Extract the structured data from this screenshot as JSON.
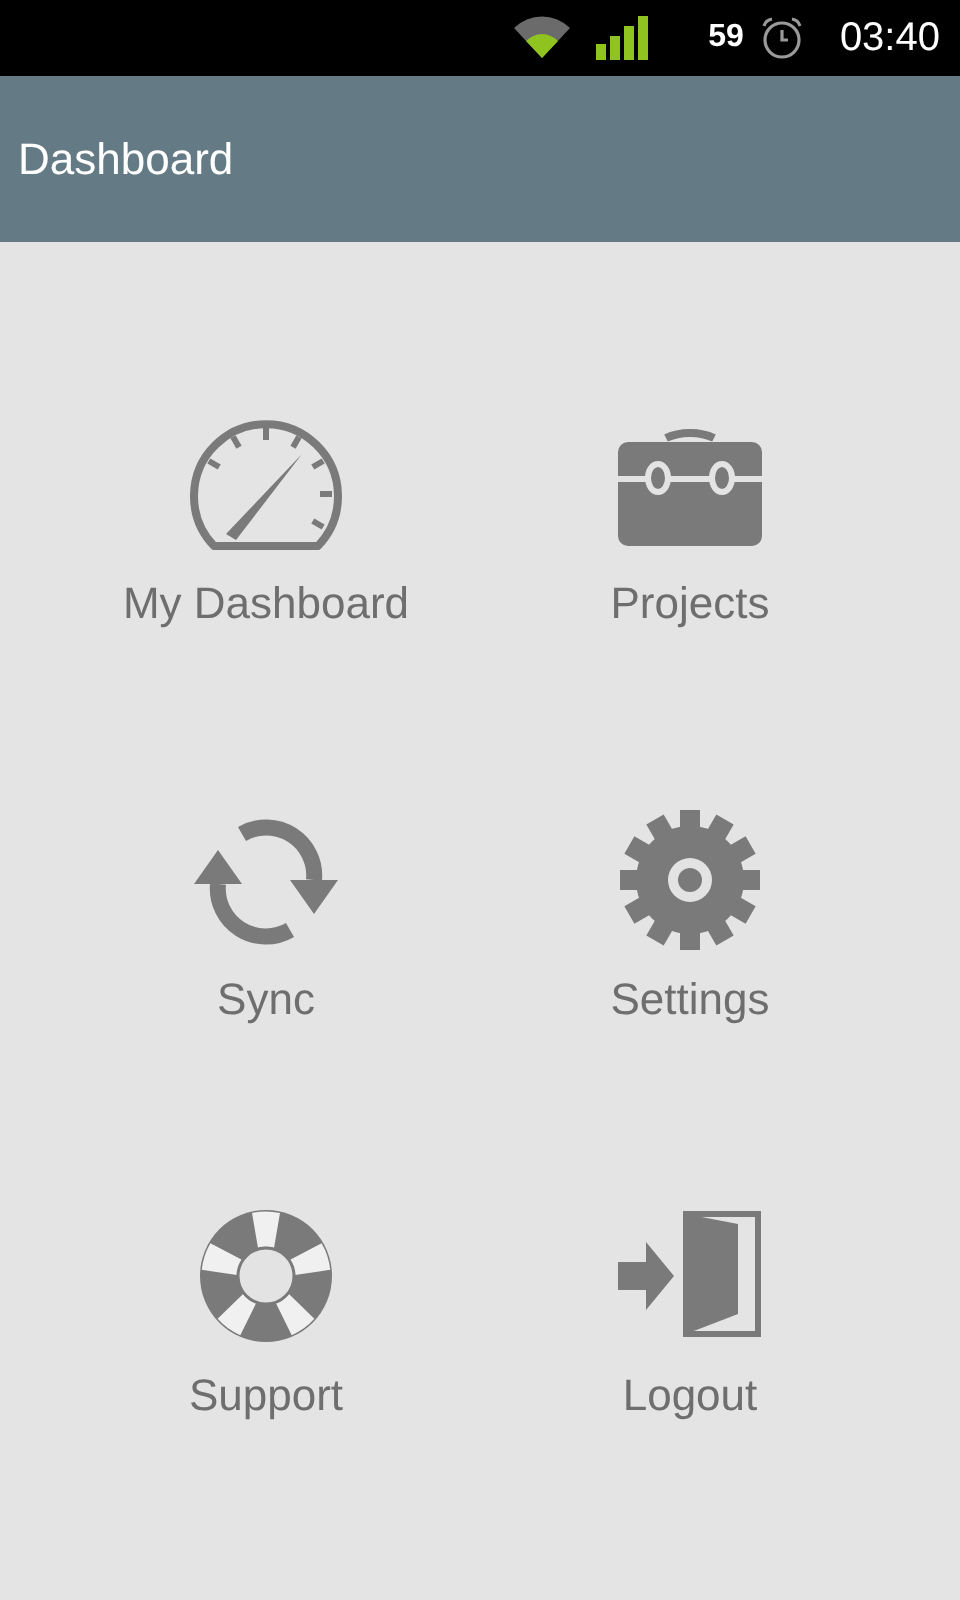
{
  "status_bar": {
    "battery": "59",
    "time": "03:40"
  },
  "header": {
    "title": "Dashboard"
  },
  "tiles": [
    {
      "kind": "dashboard",
      "label": "My Dashboard"
    },
    {
      "kind": "projects",
      "label": "Projects"
    },
    {
      "kind": "sync",
      "label": "Sync"
    },
    {
      "kind": "settings",
      "label": "Settings"
    },
    {
      "kind": "support",
      "label": "Support"
    },
    {
      "kind": "logout",
      "label": "Logout"
    }
  ]
}
